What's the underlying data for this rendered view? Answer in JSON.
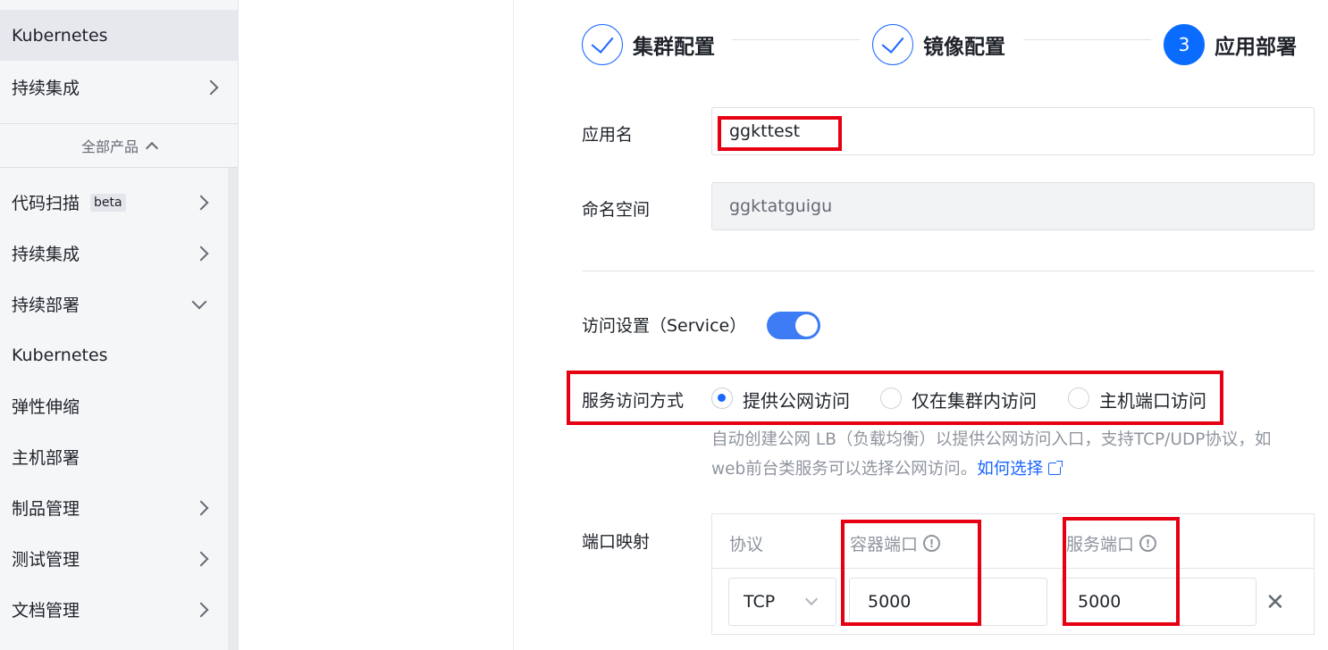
{
  "sidebar": {
    "top_items": [
      {
        "label": "Kubernetes",
        "active": true,
        "chevron": ""
      },
      {
        "label": "持续集成",
        "active": false,
        "chevron": "right"
      }
    ],
    "all_products_label": "全部产品",
    "items": [
      {
        "label": "代码扫描",
        "badge": "beta",
        "chevron": "right"
      },
      {
        "label": "持续集成",
        "badge": "",
        "chevron": "right"
      },
      {
        "label": "持续部署",
        "badge": "",
        "chevron": "down"
      },
      {
        "label": "Kubernetes",
        "badge": "",
        "chevron": ""
      },
      {
        "label": "弹性伸缩",
        "badge": "",
        "chevron": ""
      },
      {
        "label": "主机部署",
        "badge": "",
        "chevron": ""
      },
      {
        "label": "制品管理",
        "badge": "",
        "chevron": "right"
      },
      {
        "label": "测试管理",
        "badge": "",
        "chevron": "right"
      },
      {
        "label": "文档管理",
        "badge": "",
        "chevron": "right"
      }
    ]
  },
  "steps": [
    {
      "label": "集群配置",
      "state": "done",
      "number": ""
    },
    {
      "label": "镜像配置",
      "state": "done",
      "number": ""
    },
    {
      "label": "应用部署",
      "state": "current",
      "number": "3"
    }
  ],
  "form": {
    "app_name_label": "应用名",
    "app_name_value": "ggkttest",
    "namespace_label": "命名空间",
    "namespace_value": "ggktatguigu",
    "service_label": "访问设置（Service）",
    "service_enabled": true,
    "access_mode_label": "服务访问方式",
    "access_modes": [
      {
        "label": "提供公网访问",
        "selected": true
      },
      {
        "label": "仅在集群内访问",
        "selected": false
      },
      {
        "label": "主机端口访问",
        "selected": false
      }
    ],
    "hint_text": "自动创建公网 LB（负载均衡）以提供公网访问入口，支持TCP/UDP协议，如web前台类服务可以选择公网访问。",
    "hint_link": "如何选择",
    "port_mapping_label": "端口映射",
    "port_table": {
      "headers": [
        "协议",
        "容器端口",
        "服务端口"
      ],
      "rows": [
        {
          "protocol": "TCP",
          "container_port": "5000",
          "service_port": "5000"
        }
      ],
      "remove_label": "✕"
    }
  },
  "colors": {
    "accent": "#1a66ff",
    "highlight_box": "#e60012",
    "toggle_on": "#3d7cf5"
  }
}
